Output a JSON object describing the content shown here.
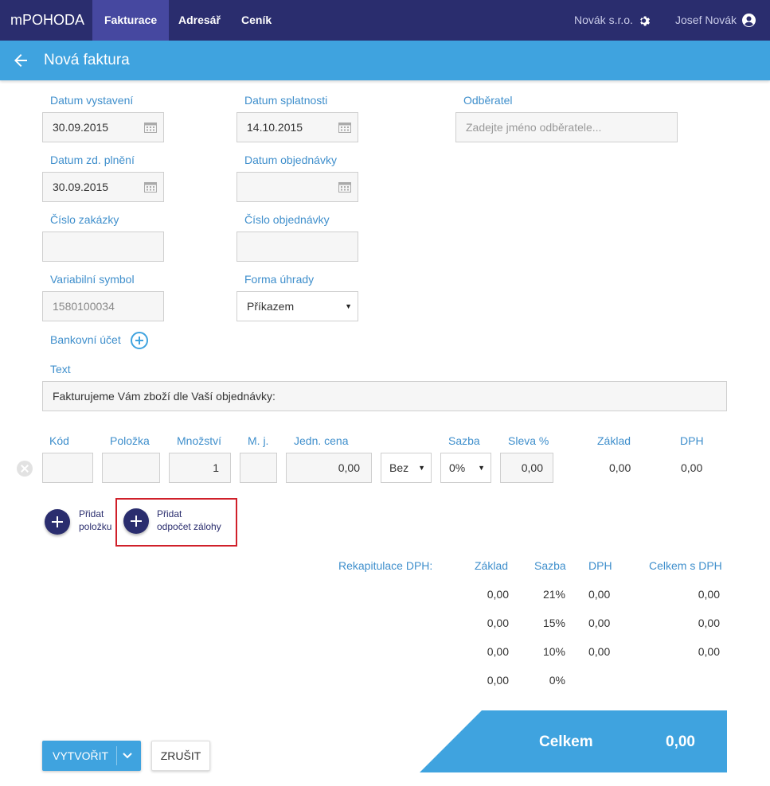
{
  "app": {
    "brand": "mPOHODA"
  },
  "nav": {
    "items": [
      {
        "label": "Fakturace"
      },
      {
        "label": "Adresář"
      },
      {
        "label": "Ceník"
      }
    ]
  },
  "header": {
    "company": "Novák s.r.o.",
    "user": "Josef Novák"
  },
  "page": {
    "title": "Nová faktura"
  },
  "form": {
    "datum_vystaveni": {
      "label": "Datum vystavení",
      "value": "30.09.2015"
    },
    "datum_splatnosti": {
      "label": "Datum splatnosti",
      "value": "14.10.2015"
    },
    "odberatel": {
      "label": "Odběratel",
      "placeholder": "Zadejte jméno odběratele..."
    },
    "datum_zd_plneni": {
      "label": "Datum zd. plnění",
      "value": "30.09.2015"
    },
    "datum_objednavky": {
      "label": "Datum objednávky",
      "value": ""
    },
    "cislo_zakazky": {
      "label": "Číslo zakázky",
      "value": ""
    },
    "cislo_objednavky": {
      "label": "Číslo objednávky",
      "value": ""
    },
    "variabilni_symbol": {
      "label": "Variabilní symbol",
      "value": "1580100034"
    },
    "forma_uhrady": {
      "label": "Forma úhrady",
      "value": "Příkazem"
    },
    "bankovni_ucet": {
      "label": "Bankovní účet"
    },
    "text": {
      "label": "Text",
      "value": "Fakturujeme Vám zboží dle Vaší objednávky:"
    }
  },
  "items_table": {
    "headers": {
      "kod": "Kód",
      "polozka": "Položka",
      "mnozstvi": "Množství",
      "mj": "M. j.",
      "jedn_cena": "Jedn. cena",
      "sazba": "Sazba",
      "sleva": "Sleva %",
      "zaklad": "Základ",
      "dph": "DPH"
    },
    "row": {
      "kod": "",
      "polozka": "",
      "mnozstvi": "1",
      "mj": "",
      "jedn_cena": "0,00",
      "dph_type": "Bez",
      "sazba": "0%",
      "sleva": "0,00",
      "zaklad": "0,00",
      "dph": "0,00"
    }
  },
  "actions": {
    "add_item_line1": "Přidat",
    "add_item_line2": "položku",
    "add_deposit_line1": "Přidat",
    "add_deposit_line2": "odpočet zálohy"
  },
  "recap": {
    "title": "Rekapitulace DPH:",
    "headers": {
      "zaklad": "Základ",
      "sazba": "Sazba",
      "dph": "DPH",
      "celkem": "Celkem s DPH"
    },
    "rows": [
      {
        "zaklad": "0,00",
        "sazba": "21%",
        "dph": "0,00",
        "celkem": "0,00"
      },
      {
        "zaklad": "0,00",
        "sazba": "15%",
        "dph": "0,00",
        "celkem": "0,00"
      },
      {
        "zaklad": "0,00",
        "sazba": "10%",
        "dph": "0,00",
        "celkem": "0,00"
      },
      {
        "zaklad": "0,00",
        "sazba": "0%"
      }
    ]
  },
  "total": {
    "label": "Celkem",
    "value": "0,00"
  },
  "buttons": {
    "create": "VYTVOŘIT",
    "cancel": "ZRUŠIT"
  },
  "colors": {
    "nav_bg": "#2a2d6e",
    "accent": "#3fa3df",
    "label": "#3f8fcc",
    "highlight": "#d0202a"
  }
}
